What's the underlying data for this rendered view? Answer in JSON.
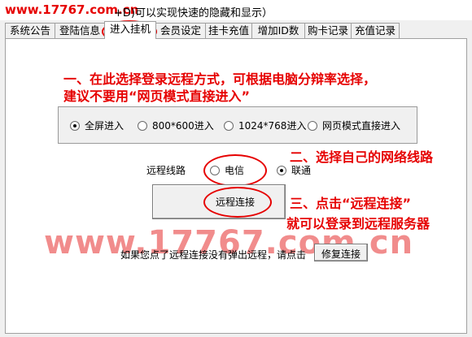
{
  "window": {
    "watermark_top": "www.17767.com.cn",
    "title_suffix": "+D)可以实现快速的隐藏和显示）"
  },
  "tabs": [
    {
      "label": "系统公告"
    },
    {
      "label": "登陆信息"
    },
    {
      "label": "进入挂机"
    },
    {
      "label": "会员设定"
    },
    {
      "label": "挂卡充值"
    },
    {
      "label": "增加ID数"
    },
    {
      "label": "购卡记录"
    },
    {
      "label": "充值记录"
    }
  ],
  "annotations": {
    "step1_line1": "一、在此选择登录远程方式，可根据电脑分辩率选择，",
    "step1_line2": "建议不要用“网页模式直接进入”",
    "step2": "二、选择自己的网络线路",
    "step3_line1": "三、点击“远程连接”",
    "step3_line2": "就可以登录到远程服务器"
  },
  "login_mode": {
    "options": [
      {
        "label": "全屏进入",
        "checked": true
      },
      {
        "label": "800*600进入",
        "checked": false
      },
      {
        "label": "1024*768进入",
        "checked": false
      },
      {
        "label": "网页模式直接进入",
        "checked": false
      }
    ]
  },
  "line_select": {
    "label": "远程线路",
    "options": [
      {
        "label": "电信",
        "checked": false
      },
      {
        "label": "联通",
        "checked": true
      }
    ]
  },
  "connect_button": {
    "label": "远程连接"
  },
  "watermark_big": "www.17767.com.cn",
  "repair": {
    "hint": "如果您点了远程连接没有弹出远程，请点击",
    "button_label": "修复连接"
  },
  "colors": {
    "annotation_red": "#e60000",
    "watermark_pink": "#f08080"
  }
}
